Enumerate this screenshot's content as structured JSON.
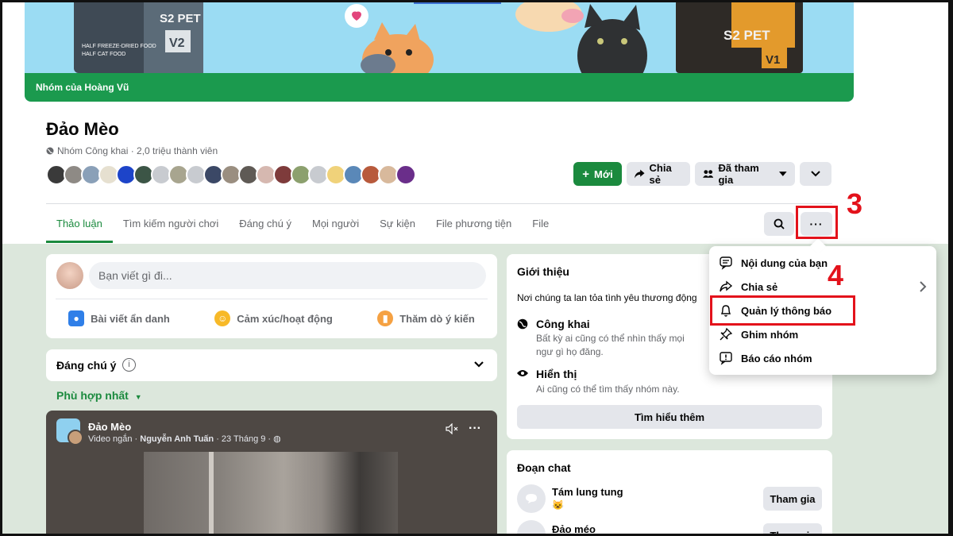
{
  "cover": {
    "group_owner_label": "Nhóm của Hoàng Vũ",
    "package_left": "S2 PET",
    "package_left_line1": "HALF FREEZE-DRIED FOOD",
    "package_left_line2": "HALF CAT FOOD",
    "package_left_badge": "V2",
    "package_right": "S2 PET",
    "package_right_badge": "V1"
  },
  "group": {
    "name": "Đảo Mèo",
    "meta": "Nhóm Công khai · 2,0 triệu thành viên"
  },
  "actions": {
    "new_label": "Mới",
    "share_label": "Chia sẻ",
    "joined_label": "Đã tham gia"
  },
  "tabs": [
    {
      "label": "Thảo luận"
    },
    {
      "label": "Tìm kiếm người chơi"
    },
    {
      "label": "Đáng chú ý"
    },
    {
      "label": "Mọi người"
    },
    {
      "label": "Sự kiện"
    },
    {
      "label": "File phương tiện"
    },
    {
      "label": "File"
    }
  ],
  "composer": {
    "placeholder": "Bạn viết gì đi...",
    "options": [
      {
        "label": "Bài viết ẩn danh",
        "icon": "anonymous-icon"
      },
      {
        "label": "Cảm xúc/hoạt động",
        "icon": "smile-icon"
      },
      {
        "label": "Thăm dò ý kiến",
        "icon": "poll-icon"
      }
    ]
  },
  "featured": {
    "title": "Đáng chú ý",
    "sort_label": "Phù hợp nhất"
  },
  "video_post": {
    "author": "Đảo Mèo",
    "meta_prefix": "Video ngắn · ",
    "meta_author": "Nguyễn Anh Tuấn",
    "meta_suffix": " · 23 Tháng 9 · "
  },
  "about": {
    "title": "Giới thiệu",
    "description": "Nơi chúng ta lan tỏa tình yêu thương động",
    "public_title": "Công khai",
    "public_desc": "Bất kỳ ai cũng có thể nhìn thấy mọi ngư gì họ đăng.",
    "visible_title": "Hiển thị",
    "visible_desc": "Ai cũng có thể tìm thấy nhóm này.",
    "learn_more": "Tìm hiểu thêm"
  },
  "chats": {
    "title": "Đoạn chat",
    "items": [
      {
        "name": "Tám lung tung",
        "sub": "😺",
        "join": "Tham gia"
      },
      {
        "name": "Đảo méo",
        "sub": "",
        "join": "Tham gia"
      }
    ]
  },
  "menu": {
    "items": [
      {
        "label": "Nội dung của bạn",
        "icon": "content-icon"
      },
      {
        "label": "Chia sẻ",
        "icon": "share-icon"
      },
      {
        "label": "Quản lý thông báo",
        "icon": "bell-icon"
      },
      {
        "label": "Ghim nhóm",
        "icon": "pin-icon"
      },
      {
        "label": "Báo cáo nhóm",
        "icon": "report-icon"
      }
    ]
  },
  "annotations": {
    "step3": "3",
    "step4": "4",
    "color": "#e3121b"
  },
  "colors": {
    "brand_green": "#1b8a3e",
    "cover_bar": "#1b9a4e",
    "page_bg": "#dce7dc"
  }
}
